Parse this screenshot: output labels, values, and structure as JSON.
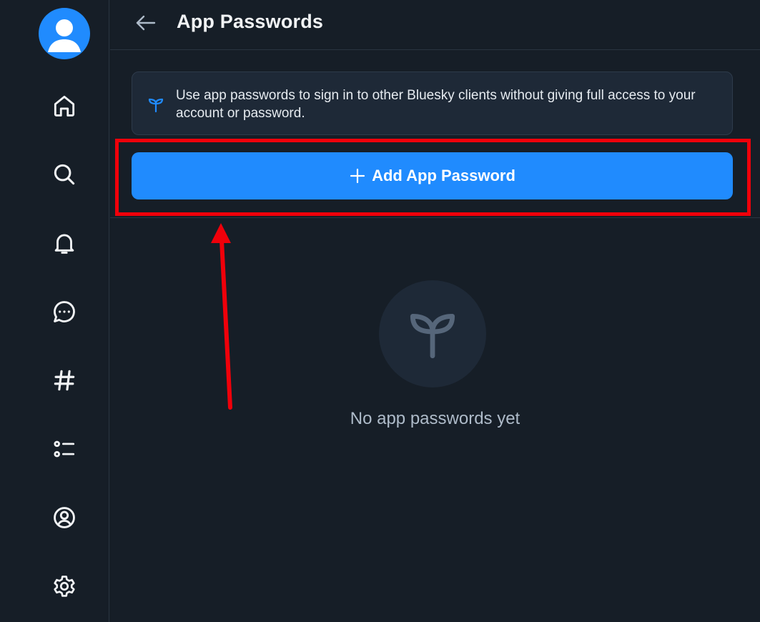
{
  "header": {
    "title": "App Passwords",
    "back_icon": "arrow-left-icon"
  },
  "sidebar": {
    "items": [
      {
        "name": "avatar",
        "icon": "user-avatar"
      },
      {
        "name": "home",
        "icon": "home-icon"
      },
      {
        "name": "search",
        "icon": "search-icon"
      },
      {
        "name": "notifications",
        "icon": "bell-icon"
      },
      {
        "name": "chat",
        "icon": "chat-bubble-icon"
      },
      {
        "name": "feeds",
        "icon": "hashtag-icon"
      },
      {
        "name": "lists",
        "icon": "list-icon"
      },
      {
        "name": "profile",
        "icon": "user-circle-icon"
      },
      {
        "name": "settings",
        "icon": "gear-icon"
      }
    ]
  },
  "info": {
    "icon": "sprout-icon",
    "text": "Use app passwords to sign in to other Bluesky clients without giving full access to your account or password."
  },
  "add_button": {
    "icon": "plus-icon",
    "label": "Add App Password"
  },
  "empty_state": {
    "icon": "sprout-icon",
    "text": "No app passwords yet"
  },
  "colors": {
    "background": "#161e27",
    "accent": "#208bfe",
    "annotation": "#f0000a"
  }
}
